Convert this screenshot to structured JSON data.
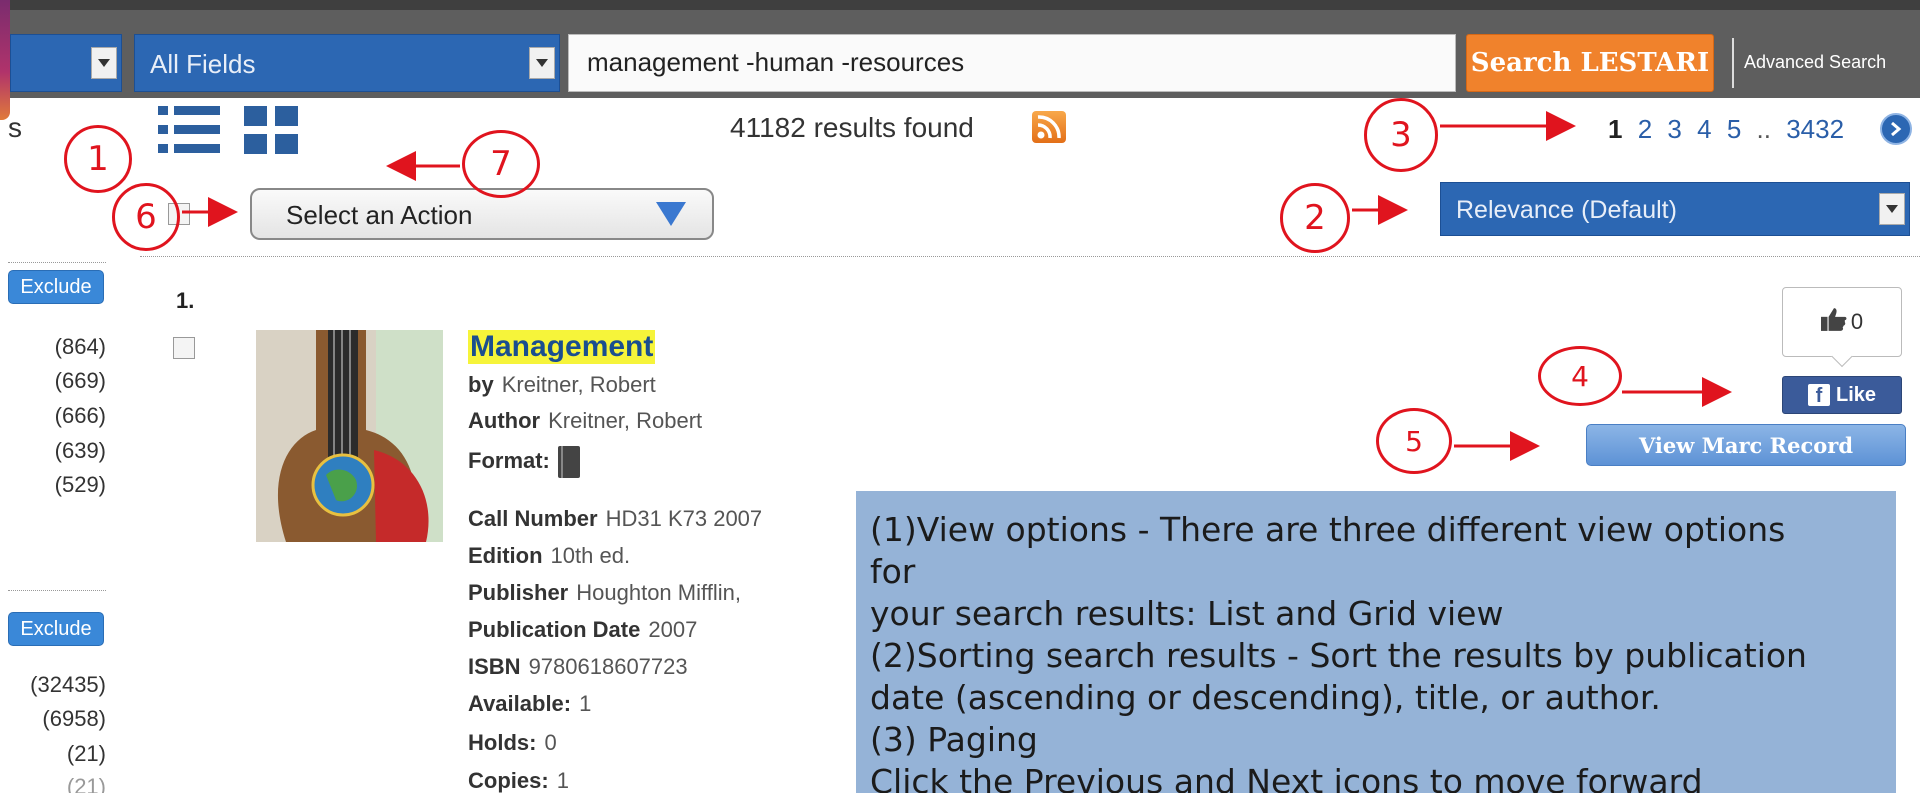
{
  "search": {
    "field_value": "All Fields",
    "query": "management -human -resources",
    "submit_label": "Search LESTARI",
    "advanced_label": "Advanced Search"
  },
  "facets": {
    "title_fragment": "s",
    "groups": [
      {
        "exclude_label": "Exclude",
        "counts": [
          "(864)",
          "(669)",
          "(666)",
          "(639)",
          "(529)"
        ]
      },
      {
        "exclude_label": "Exclude",
        "counts": [
          "(32435)",
          "(6958)",
          "(21)",
          "(21)"
        ]
      }
    ]
  },
  "results": {
    "count_text": "41182 results found",
    "pager": {
      "pages": [
        "1",
        "2",
        "3",
        "4",
        "5",
        "..",
        "3432"
      ],
      "current": "1"
    },
    "action_select": "Select an Action",
    "sort_select": "Relevance (Default)"
  },
  "record": {
    "number": "1.",
    "title": "Management",
    "fields": [
      {
        "label": "by",
        "value": "Kreitner, Robert"
      },
      {
        "label": "Author",
        "value": "Kreitner, Robert"
      },
      {
        "label": "Format:",
        "value": ""
      },
      {
        "label": "Call Number",
        "value": "HD31 K73 2007"
      },
      {
        "label": "Edition",
        "value": "10th ed."
      },
      {
        "label": "Publisher",
        "value": "Houghton Mifflin,"
      },
      {
        "label": "Publication Date",
        "value": "2007"
      },
      {
        "label": "ISBN",
        "value": "9780618607723"
      },
      {
        "label": "Available:",
        "value": "1"
      },
      {
        "label": "Holds:",
        "value": "0"
      },
      {
        "label": "Copies:",
        "value": "1"
      }
    ],
    "like_count": "0",
    "fb_like_label": "Like",
    "marc_label": "View Marc Record"
  },
  "annotations": [
    "1",
    "2",
    "3",
    "4",
    "5",
    "6",
    "7"
  ],
  "help_text": [
    "(1)View options - There are three different view options",
    "for",
    "your search results: List and Grid view",
    "(2)Sorting search results - Sort the results by publication",
    "date  (ascending or descending), title, or author.",
    "(3) Paging",
    "Click the Previous and Next icons to move forward"
  ],
  "icons": {
    "list_view": "list-view-icon",
    "grid_view": "grid-view-icon",
    "rss": "rss-icon",
    "next": "chevron-right-icon",
    "thumb": "thumbs-up-icon",
    "facebook": "facebook-icon",
    "format": "book-icon"
  },
  "colors": {
    "select_blue": "#2c67b3",
    "search_orange": "#f0822c",
    "annotation_red": "#e0141e",
    "help_bg": "#95b3d7",
    "title_highlight": "#f6f43a"
  }
}
